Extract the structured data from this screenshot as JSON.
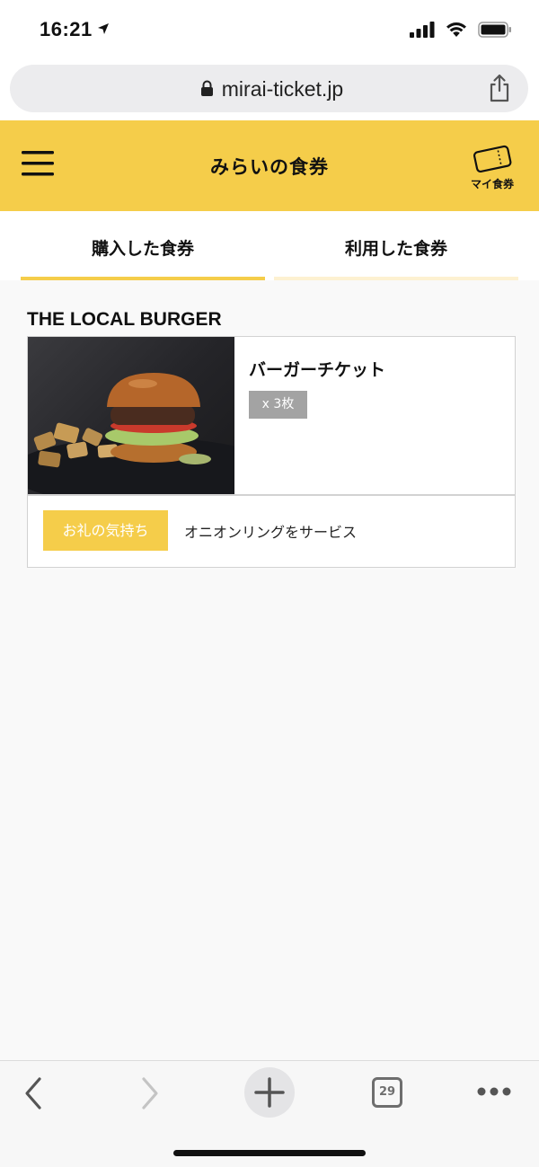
{
  "status_bar": {
    "time": "16:21",
    "icons": [
      "location-arrow-icon",
      "signal-icon",
      "wifi-icon",
      "battery-icon"
    ]
  },
  "browser": {
    "url": "mirai-ticket.jp"
  },
  "header": {
    "brand": "みらいの食券",
    "my_ticket_label": "マイ食券",
    "accent_color": "#f5cd4a"
  },
  "tabs": [
    {
      "label": "購入した食券",
      "active": true
    },
    {
      "label": "利用した食券",
      "active": false
    }
  ],
  "shop": {
    "name": "THE LOCAL BURGER"
  },
  "ticket": {
    "title": "バーガーチケット",
    "quantity": "x 3枚",
    "gift_label": "お礼の気持ち",
    "gift_text": "オニオンリングをサービス"
  },
  "toolbar": {
    "tab_count": "29"
  }
}
